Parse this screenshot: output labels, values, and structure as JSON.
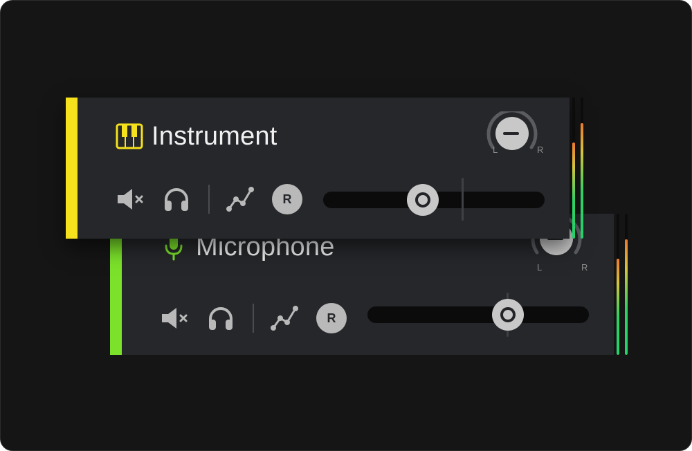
{
  "tracks": [
    {
      "name": "Instrument",
      "icon": "piano-keys-icon",
      "color": "#f5e11c",
      "mute_icon": "speaker-muted-icon",
      "solo_icon": "headphones-icon",
      "automation_icon": "automation-curve-icon",
      "record_label": "R",
      "pan": {
        "left_label": "L",
        "right_label": "R",
        "value": 0
      },
      "volume_fraction": 0.45,
      "meters": {
        "left": 0.68,
        "right": 0.82
      }
    },
    {
      "name": "Microphone",
      "icon": "microphone-icon",
      "color": "#7be12a",
      "mute_icon": "speaker-muted-icon",
      "solo_icon": "headphones-icon",
      "automation_icon": "automation-curve-icon",
      "record_label": "R",
      "pan": {
        "left_label": "L",
        "right_label": "R",
        "value": 0
      },
      "volume_fraction": 0.63,
      "meters": {
        "left": 0.68,
        "right": 0.82
      }
    }
  ]
}
